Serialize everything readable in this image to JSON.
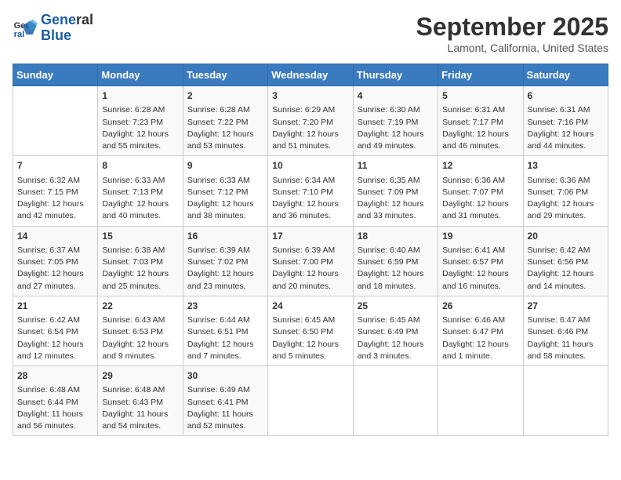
{
  "logo": {
    "line1": "General",
    "line2": "Blue"
  },
  "title": "September 2025",
  "subtitle": "Lamont, California, United States",
  "days_of_week": [
    "Sunday",
    "Monday",
    "Tuesday",
    "Wednesday",
    "Thursday",
    "Friday",
    "Saturday"
  ],
  "weeks": [
    [
      {
        "day": "",
        "info": ""
      },
      {
        "day": "1",
        "info": "Sunrise: 6:28 AM\nSunset: 7:23 PM\nDaylight: 12 hours\nand 55 minutes."
      },
      {
        "day": "2",
        "info": "Sunrise: 6:28 AM\nSunset: 7:22 PM\nDaylight: 12 hours\nand 53 minutes."
      },
      {
        "day": "3",
        "info": "Sunrise: 6:29 AM\nSunset: 7:20 PM\nDaylight: 12 hours\nand 51 minutes."
      },
      {
        "day": "4",
        "info": "Sunrise: 6:30 AM\nSunset: 7:19 PM\nDaylight: 12 hours\nand 49 minutes."
      },
      {
        "day": "5",
        "info": "Sunrise: 6:31 AM\nSunset: 7:17 PM\nDaylight: 12 hours\nand 46 minutes."
      },
      {
        "day": "6",
        "info": "Sunrise: 6:31 AM\nSunset: 7:16 PM\nDaylight: 12 hours\nand 44 minutes."
      }
    ],
    [
      {
        "day": "7",
        "info": "Sunrise: 6:32 AM\nSunset: 7:15 PM\nDaylight: 12 hours\nand 42 minutes."
      },
      {
        "day": "8",
        "info": "Sunrise: 6:33 AM\nSunset: 7:13 PM\nDaylight: 12 hours\nand 40 minutes."
      },
      {
        "day": "9",
        "info": "Sunrise: 6:33 AM\nSunset: 7:12 PM\nDaylight: 12 hours\nand 38 minutes."
      },
      {
        "day": "10",
        "info": "Sunrise: 6:34 AM\nSunset: 7:10 PM\nDaylight: 12 hours\nand 36 minutes."
      },
      {
        "day": "11",
        "info": "Sunrise: 6:35 AM\nSunset: 7:09 PM\nDaylight: 12 hours\nand 33 minutes."
      },
      {
        "day": "12",
        "info": "Sunrise: 6:36 AM\nSunset: 7:07 PM\nDaylight: 12 hours\nand 31 minutes."
      },
      {
        "day": "13",
        "info": "Sunrise: 6:36 AM\nSunset: 7:06 PM\nDaylight: 12 hours\nand 29 minutes."
      }
    ],
    [
      {
        "day": "14",
        "info": "Sunrise: 6:37 AM\nSunset: 7:05 PM\nDaylight: 12 hours\nand 27 minutes."
      },
      {
        "day": "15",
        "info": "Sunrise: 6:38 AM\nSunset: 7:03 PM\nDaylight: 12 hours\nand 25 minutes."
      },
      {
        "day": "16",
        "info": "Sunrise: 6:39 AM\nSunset: 7:02 PM\nDaylight: 12 hours\nand 23 minutes."
      },
      {
        "day": "17",
        "info": "Sunrise: 6:39 AM\nSunset: 7:00 PM\nDaylight: 12 hours\nand 20 minutes."
      },
      {
        "day": "18",
        "info": "Sunrise: 6:40 AM\nSunset: 6:59 PM\nDaylight: 12 hours\nand 18 minutes."
      },
      {
        "day": "19",
        "info": "Sunrise: 6:41 AM\nSunset: 6:57 PM\nDaylight: 12 hours\nand 16 minutes."
      },
      {
        "day": "20",
        "info": "Sunrise: 6:42 AM\nSunset: 6:56 PM\nDaylight: 12 hours\nand 14 minutes."
      }
    ],
    [
      {
        "day": "21",
        "info": "Sunrise: 6:42 AM\nSunset: 6:54 PM\nDaylight: 12 hours\nand 12 minutes."
      },
      {
        "day": "22",
        "info": "Sunrise: 6:43 AM\nSunset: 6:53 PM\nDaylight: 12 hours\nand 9 minutes."
      },
      {
        "day": "23",
        "info": "Sunrise: 6:44 AM\nSunset: 6:51 PM\nDaylight: 12 hours\nand 7 minutes."
      },
      {
        "day": "24",
        "info": "Sunrise: 6:45 AM\nSunset: 6:50 PM\nDaylight: 12 hours\nand 5 minutes."
      },
      {
        "day": "25",
        "info": "Sunrise: 6:45 AM\nSunset: 6:49 PM\nDaylight: 12 hours\nand 3 minutes."
      },
      {
        "day": "26",
        "info": "Sunrise: 6:46 AM\nSunset: 6:47 PM\nDaylight: 12 hours\nand 1 minute."
      },
      {
        "day": "27",
        "info": "Sunrise: 6:47 AM\nSunset: 6:46 PM\nDaylight: 11 hours\nand 58 minutes."
      }
    ],
    [
      {
        "day": "28",
        "info": "Sunrise: 6:48 AM\nSunset: 6:44 PM\nDaylight: 11 hours\nand 56 minutes."
      },
      {
        "day": "29",
        "info": "Sunrise: 6:48 AM\nSunset: 6:43 PM\nDaylight: 11 hours\nand 54 minutes."
      },
      {
        "day": "30",
        "info": "Sunrise: 6:49 AM\nSunset: 6:41 PM\nDaylight: 11 hours\nand 52 minutes."
      },
      {
        "day": "",
        "info": ""
      },
      {
        "day": "",
        "info": ""
      },
      {
        "day": "",
        "info": ""
      },
      {
        "day": "",
        "info": ""
      }
    ]
  ]
}
